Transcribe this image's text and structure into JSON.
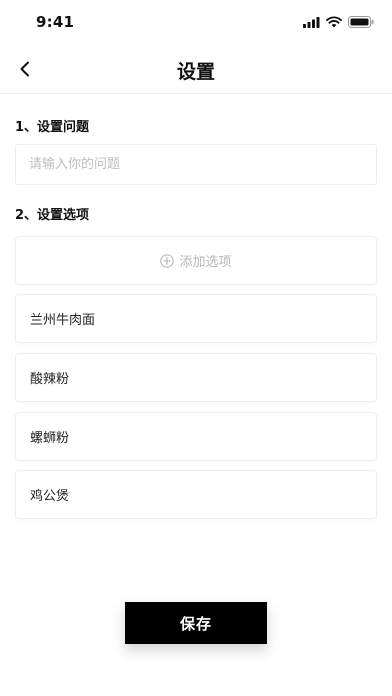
{
  "status_bar": {
    "time": "9:41"
  },
  "nav": {
    "title": "设置",
    "back_icon": "chevron-left-icon"
  },
  "question_section": {
    "label": "1、设置问题",
    "placeholder": "请输入你的问题",
    "value": ""
  },
  "options_section": {
    "label": "2、设置选项",
    "add_label": "添加选项",
    "add_icon": "plus-circle-icon",
    "options": [
      "兰州牛肉面",
      "酸辣粉",
      "螺蛳粉",
      "鸡公煲"
    ]
  },
  "footer": {
    "save_label": "保存"
  },
  "colors": {
    "primary_button": "#000000",
    "placeholder": "#bdbdbd",
    "border": "#eeeeee"
  }
}
